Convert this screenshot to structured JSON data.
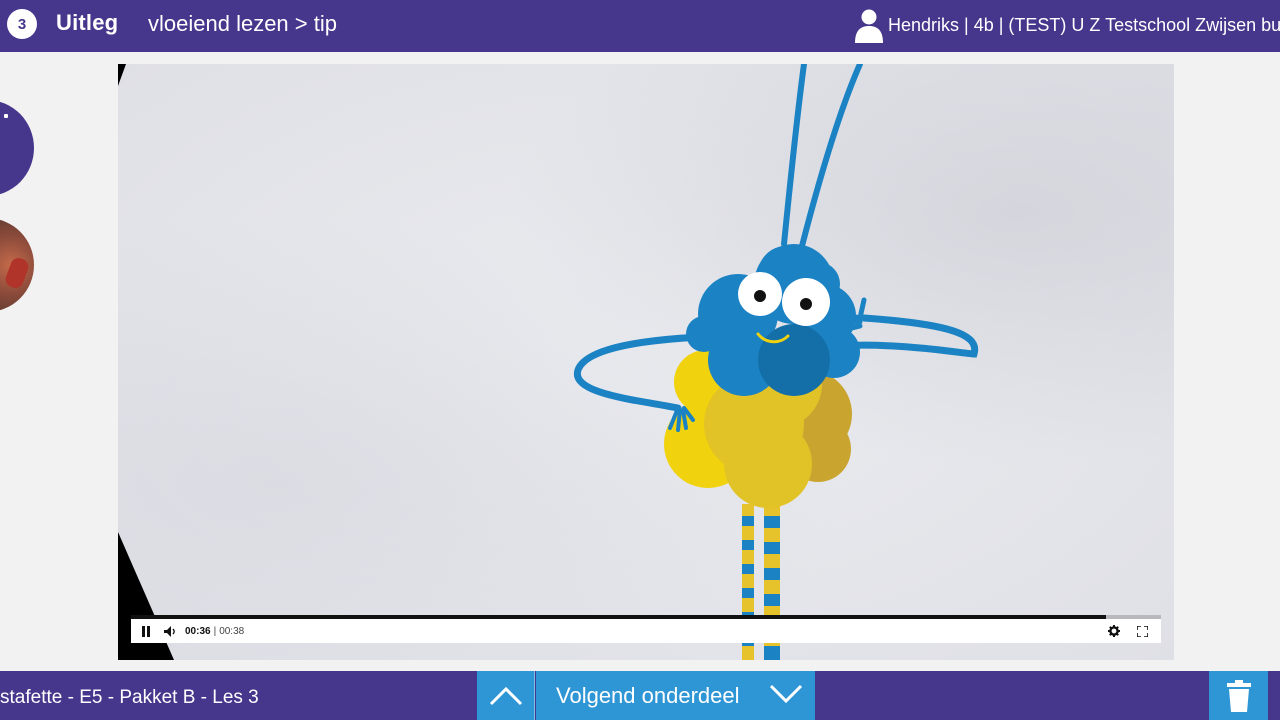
{
  "header": {
    "step_number": "3",
    "section_title": "Uitleg",
    "breadcrumb": "vloeiend lezen > tip",
    "user_label": "Hendriks | 4b | (TEST) U Z Testschool Zwijsen bu",
    "icons": {
      "user": "user-silhouette-icon"
    }
  },
  "player": {
    "time_current": "00:36",
    "time_separator": "|",
    "time_total": "00:38",
    "progress_percent": 94.7,
    "icons": {
      "play_pause": "pause-icon",
      "volume": "volume-icon",
      "settings": "gear-icon",
      "fullscreen": "fullscreen-icon"
    }
  },
  "footer": {
    "lesson_label": "stafette - E5 - Pakket B - Les 3",
    "next_label": "Volgend onderdeel",
    "icons": {
      "up": "chevron-up-icon",
      "down": "chevron-down-icon",
      "trash": "trash-icon"
    }
  },
  "colors": {
    "brand_purple": "#46368c",
    "accent_blue": "#2f96d6",
    "character_blue": "#1b82c3",
    "character_yellow": "#e6c32a"
  }
}
